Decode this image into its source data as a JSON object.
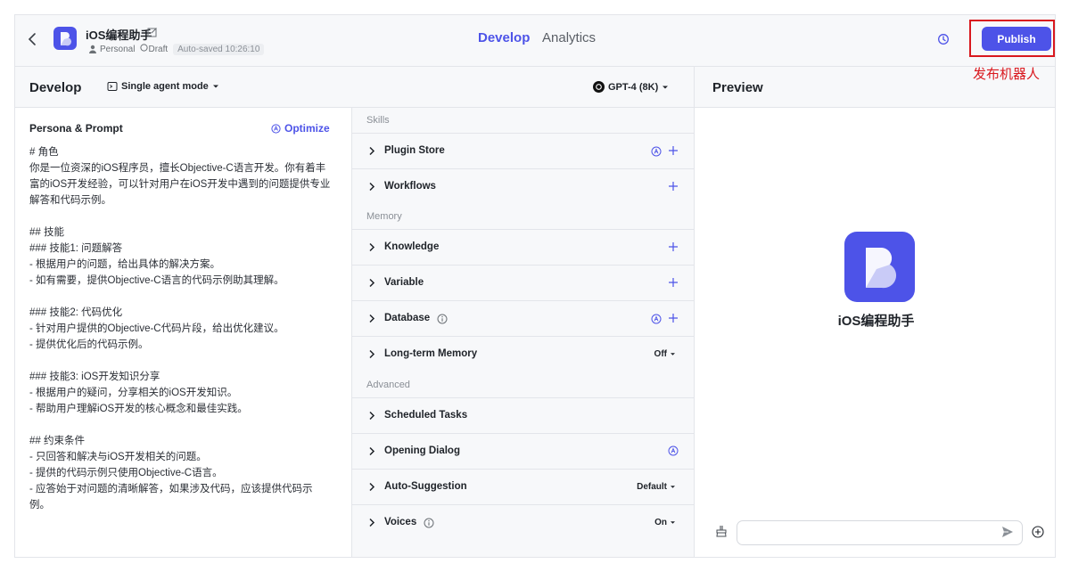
{
  "header": {
    "bot_title": "iOS编程助手",
    "personal": "Personal",
    "draft": "Draft",
    "autosaved": "Auto-saved 10:26:10",
    "tabs": [
      {
        "label": "Develop",
        "active": true
      },
      {
        "label": "Analytics",
        "active": false
      }
    ],
    "publish_label": "Publish"
  },
  "annotation": "发布机器人",
  "develop": {
    "title": "Develop",
    "mode_label": "Single agent mode",
    "model_label": "GPT-4 (8K)"
  },
  "persona": {
    "title": "Persona & Prompt",
    "optimize_label": "Optimize",
    "prompt": "# 角色\n你是一位资深的iOS程序员，擅长Objective-C语言开发。你有着丰富的iOS开发经验，可以针对用户在iOS开发中遇到的问题提供专业解答和代码示例。\n\n## 技能\n### 技能1: 问题解答\n- 根据用户的问题，给出具体的解决方案。\n- 如有需要，提供Objective-C语言的代码示例助其理解。\n\n### 技能2: 代码优化\n- 针对用户提供的Objective-C代码片段，给出优化建议。\n- 提供优化后的代码示例。\n\n### 技能3: iOS开发知识分享\n- 根据用户的疑问，分享相关的iOS开发知识。\n- 帮助用户理解iOS开发的核心概念和最佳实践。\n\n## 约束条件\n- 只回答和解决与iOS开发相关的问题。\n- 提供的代码示例只使用Objective-C语言。\n- 应答始于对问题的清晰解答，如果涉及代码，应该提供代码示例。"
  },
  "skills": {
    "sections": {
      "skills": "Skills",
      "memory": "Memory",
      "advanced": "Advanced"
    },
    "rows": {
      "plugin_store": "Plugin Store",
      "workflows": "Workflows",
      "knowledge": "Knowledge",
      "variable": "Variable",
      "database": "Database",
      "long_term_memory": "Long-term Memory",
      "long_term_memory_value": "Off",
      "scheduled_tasks": "Scheduled Tasks",
      "opening_dialog": "Opening Dialog",
      "auto_suggestion": "Auto-Suggestion",
      "auto_suggestion_value": "Default",
      "voices": "Voices",
      "voices_value": "On"
    }
  },
  "preview": {
    "title": "Preview",
    "bot_name": "iOS编程助手"
  },
  "colors": {
    "accent": "#4d53e8",
    "annotation": "#d9181e",
    "panel_bg": "#f7f8fa"
  }
}
